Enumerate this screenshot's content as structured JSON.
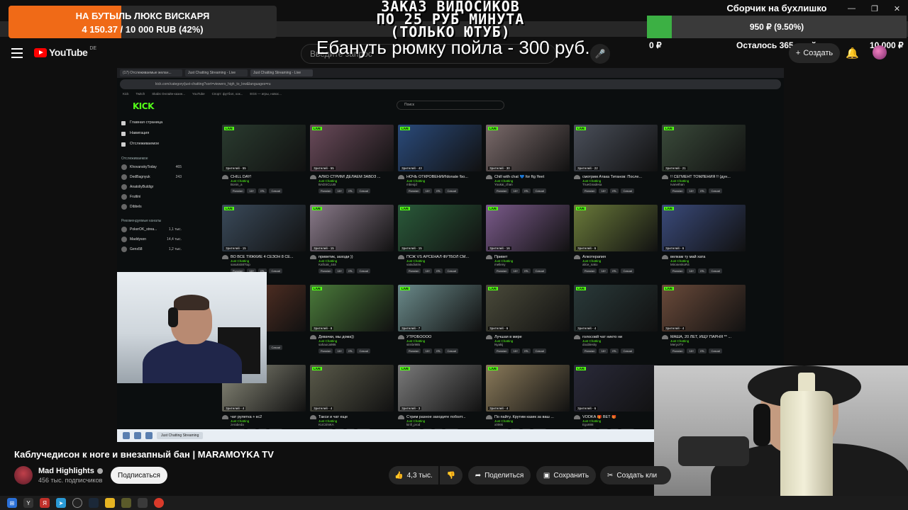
{
  "donation": {
    "title": "НА БУТЫЛЬ ЛЮКС ВИСКАРЯ",
    "amount": "4 150.37 / 10 000 RUB (42%)",
    "progress": 0.42,
    "color": "#f06a17"
  },
  "order": {
    "title_line1": "ЗАКАЗ ВИДОСИКОВ",
    "title_line2": "ПО 25 РУБ МИНУТА",
    "title_line3": "(ТОЛЬКО ЮТУБ)",
    "line": "Ебануть рюмку пойла - 300 руб."
  },
  "collector": {
    "title": "Сборчик на бухлишко",
    "value": "950 ₽ (9.50%)",
    "progress": 0.095,
    "min": "0 ₽",
    "remaining": "Осталось 365 дней",
    "max": "10 000 ₽",
    "color": "#3cb044"
  },
  "youtube": {
    "wordmark": "YouTube",
    "region": "DE",
    "search_placeholder": "Введите запрос",
    "create_label": "Создать",
    "icons": [
      "menu-icon",
      "mic-icon",
      "bell-icon",
      "plus-icon"
    ]
  },
  "capture": {
    "tabs": [
      "(17) Отслеживаемые желан...",
      "Just Chatting Streaming - Live",
      "Just Chatting Streaming - Live"
    ],
    "url": "kick.com/category/just-chatting?sort=viewers_high_to_low&languages=ru",
    "bookmarks": [
      "Kick",
      "Twitch",
      "Skabs Онлайн-казин...",
      "YouTube",
      "Спорт: футбол, хок...",
      "EGS — игры, новос..."
    ],
    "kick_logo": "KICK",
    "search_placeholder": "Поиск",
    "side_nav": [
      "Главная страница",
      "Навигация",
      "Отслеживаемое"
    ],
    "followed_head": "Отслеживаемое",
    "followed": [
      {
        "name": "KhovanskyToday",
        "cat": "Just Chatting",
        "count": "465"
      },
      {
        "name": "DedBagnyuk",
        "cat": "Just Chatting",
        "count": "243"
      },
      {
        "name": "AnatoliyBuldigr",
        "cat": "",
        "count": ""
      },
      {
        "name": "Fruttini",
        "cat": "",
        "count": ""
      },
      {
        "name": "Dibbels",
        "cat": "",
        "count": ""
      }
    ],
    "recommended_head": "Рекомендуемые каналы",
    "recommended": [
      {
        "name": "PokerOK_strea...",
        "cat": "Poker",
        "count": "1,1 тыс."
      },
      {
        "name": "Maddyson",
        "cat": "Just Chatting",
        "count": "14,4 тыс."
      },
      {
        "name": "Gens58",
        "cat": "Slots & Casino",
        "count": "1,2 тыс."
      }
    ],
    "cards": [
      {
        "title": "CHILL DAY!",
        "user": "Bonin_a",
        "viewers": "Зрителей - 55",
        "color": "#2a3b2f"
      },
      {
        "title": "АЛКО СТРИМ! ДЕЛАЕМ ЗАВОЗ ...",
        "user": "BADSCLUB",
        "viewers": "Зрителей - 55",
        "color": "#6a4a5a"
      },
      {
        "title": "НОЧЬ ОТКРОВЕНИЙ!donate !bo...",
        "user": "mbeojd",
        "viewers": "Зрителей - 43",
        "color": "#2a4a7a"
      },
      {
        "title": "Chill with chat 💙 for ftg !feet",
        "user": "Youkai_chan",
        "viewers": "Зрителей - 30",
        "color": "#7a6a6a"
      },
      {
        "title": "смотрим Атака Титанов: После...",
        "user": "TrueGnadesa",
        "viewers": "Зрителей - 22",
        "color": "#4a4f5a"
      },
      {
        "title": "!! СЕГМЕНТ ТОМЛЕНИЯ !! (дун...",
        "user": "Ivanethan",
        "viewers": "Зрителей - 21",
        "color": "#3a4a3a"
      },
      {
        "title": "ВО ВСЕ ТЯЖКИЕ 4 СЕЗОН 8 СЕ...",
        "user": "sasuks587top",
        "viewers": "Зрителей - 15",
        "color": "#3a4a5a"
      },
      {
        "title": "приветик, заходи ))",
        "user": "Kaficak_444",
        "viewers": "Зрителей - 15",
        "color": "#8a7a8a"
      },
      {
        "title": "ПСЖ VS АРСЕНАЛ ФУТБОЛ СМ...",
        "user": "vatsdiotris",
        "viewers": "Зрителей - 15",
        "color": "#2a5a3a"
      },
      {
        "title": "Привет",
        "user": "melleny",
        "viewers": "Зрителей - 16",
        "color": "#7a5a8a"
      },
      {
        "title": "Алкотерапия",
        "user": "alice_nako",
        "viewers": "Зрителей - 6",
        "color": "#6a7a3a"
      },
      {
        "title": "велкам ту май хата",
        "user": "MironenkoR4",
        "viewers": "Зрителей - 6",
        "color": "#3a4a7a"
      },
      {
        "title": "...ости",
        "user": "",
        "viewers": "Зрителей - 7",
        "color": "#6a3a2a"
      },
      {
        "title": "Девачки, мы дома))",
        "user": "sahaoca986",
        "viewers": "Зрителей - 8",
        "color": "#4a7a3a"
      },
      {
        "title": "УТРОБОООО",
        "user": "strnbr985",
        "viewers": "Зрителей - 7",
        "color": "#6a8a8a"
      },
      {
        "title": "Лучшая в мире",
        "user": "Nyakij",
        "viewers": "Зрителей - 6",
        "color": "#4a4a3a"
      },
      {
        "title": "голосовй чат никто ни",
        "user": "doublesky",
        "viewers": "Зрителей - 4",
        "color": "#2a3a3a"
      },
      {
        "title": "МАША, 20 ЛЕТ, ИЩУ ПАРНЯ ** ...",
        "user": "MeryoTV",
        "viewers": "Зрителей - 4",
        "color": "#6a4a3a"
      },
      {
        "title": "чат рулетка + кс2",
        "user": "zerabeda",
        "viewers": "Зрителей - 4",
        "color": "#8a8a7a"
      },
      {
        "title": "Такси и чат еще",
        "user": "KUCENKA",
        "viewers": "Зрителей - 4",
        "color": "#5a5a4a"
      },
      {
        "title": "Стрим разное заходите поболт...",
        "user": "kirill_prod",
        "viewers": "Зрителей - 3",
        "color": "#7a7a7a"
      },
      {
        "title": "По пайту. Крутим казик за ваш ...",
        "user": "x006k",
        "viewers": "Зрителей - 4",
        "color": "#8a7a5a"
      },
      {
        "title": "VODKA 🎁 BET 🎁",
        "user": "Ego888",
        "viewers": "Зрителей - 6",
        "color": "#2a2a3a"
      }
    ],
    "tags": [
      "Russian",
      "18+",
      "IRL",
      "Casual"
    ],
    "category": "Just Chatting",
    "live_label": "LIVE",
    "taskbar_app": "Just Chatting Streaming"
  },
  "video": {
    "title": "Каблучедисон к ноге и внезапный бан | MARAMOYKA TV",
    "channel": "Mad Highlights",
    "subscribers": "456 тыс. подписчиков",
    "subscribe_label": "Подписаться",
    "like_count": "4,3 тыс.",
    "share_label": "Поделиться",
    "save_label": "Сохранить",
    "clip_label": "Создать кли"
  },
  "taskbar": {
    "icons": [
      "windows-icon",
      "yandex-icon",
      "yandex-alt-icon",
      "telegram-icon",
      "obs-icon",
      "steam-icon",
      "folder-icon",
      "game-icon",
      "app-icon",
      "chrome-icon"
    ]
  }
}
